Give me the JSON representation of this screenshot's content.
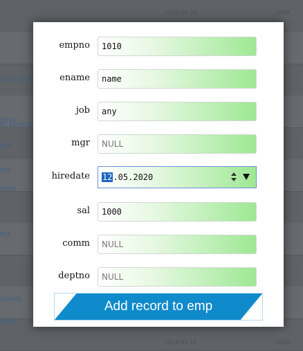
{
  "background_rows": [
    {
      "c1": "",
      "c2": "2009-06-24",
      "c3": "2008"
    },
    {
      "c1": "",
      "c2": "",
      "c3": ""
    },
    {
      "c1": "ES ASSISTAN",
      "c2": "",
      "c3": ""
    },
    {
      "c1": "LYTHC",
      "c2": "",
      "c3": ""
    },
    {
      "c1": "ES ASSISTAN",
      "c2": "",
      "c3": ""
    },
    {
      "c1": "RCK",
      "c2": "",
      "c3": ""
    },
    {
      "c1": "RCK",
      "c2": "",
      "c3": ""
    },
    {
      "c1": "AMER",
      "c2": "",
      "c3": ""
    },
    {
      "c1": "",
      "c2": "",
      "c3": ""
    },
    {
      "c1": "RCK",
      "c2": "",
      "c3": ""
    },
    {
      "c1": "",
      "c2": "",
      "c3": ""
    },
    {
      "c1": "",
      "c2": "",
      "c3": ""
    },
    {
      "c1": "ELOPER",
      "c2": "",
      "c3": ""
    },
    {
      "c1": "AMER",
      "c2": "",
      "c3": ""
    },
    {
      "c1": "",
      "c2": "2013-01-11",
      "c3": "1000"
    }
  ],
  "form": {
    "empno": {
      "label": "empno",
      "value": "1010",
      "placeholder": ""
    },
    "ename": {
      "label": "ename",
      "value": "name",
      "placeholder": ""
    },
    "job": {
      "label": "job",
      "value": "any",
      "placeholder": ""
    },
    "mgr": {
      "label": "mgr",
      "value": "",
      "placeholder": "NULL"
    },
    "hiredate": {
      "label": "hiredate",
      "day": "12",
      "rest": ".05.2020"
    },
    "sal": {
      "label": "sal",
      "value": "1000",
      "placeholder": ""
    },
    "comm": {
      "label": "comm",
      "value": "",
      "placeholder": "NULL"
    },
    "deptno": {
      "label": "deptno",
      "value": "",
      "placeholder": "NULL"
    }
  },
  "submit": {
    "label": "Add record to emp"
  },
  "colors": {
    "accent": "#0f8acb",
    "input_gradient_end": "#9ee894",
    "date_selection": "#1a62c4"
  }
}
